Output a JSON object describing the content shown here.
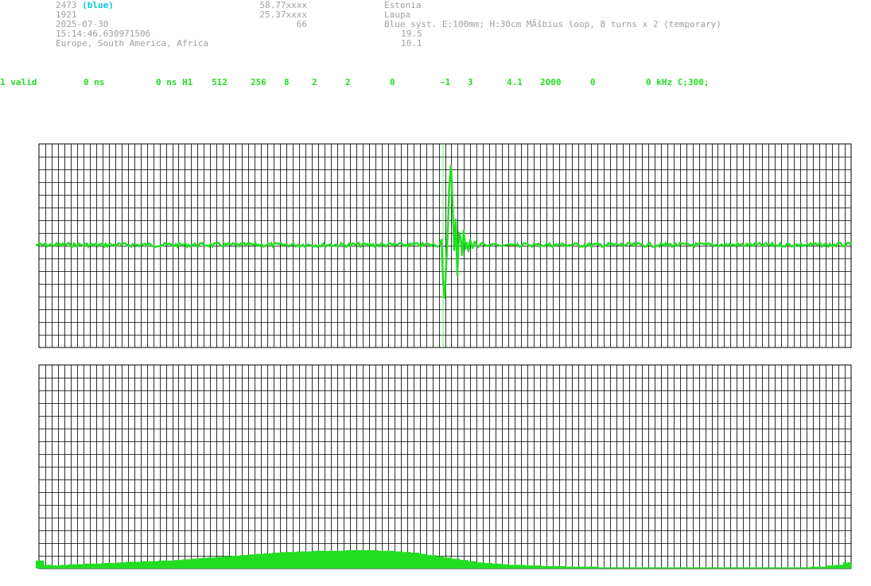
{
  "station": {
    "id": "2473",
    "color_label": "(blue)",
    "number": "1921",
    "date": "2025-07-30",
    "time": "15:14:46.630971506",
    "regions": "Europe, South America, Africa"
  },
  "coords": {
    "lat": "58.77xxxx",
    "lon": "25.37xxxx",
    "alt": "66"
  },
  "location": {
    "country": "Estonia",
    "place": "Laupa",
    "antenna": "Blue syst. E:100mm; H:30cm MÃšbius loop, 8 turns x 2 (temporary)",
    "value1": "19.5",
    "value2": "10.1"
  },
  "status_line": {
    "f01": "1 valid",
    "f02": "0 ns",
    "f03": "0 ns H1",
    "f04": "512",
    "f05": "256",
    "f06": "8",
    "f07": "2",
    "f08": "2",
    "f09": "0",
    "f10": "-1",
    "f11": "3",
    "f12": "4.1",
    "f13": "2000",
    "f14": "0",
    "f15": "0 kHz C;300;"
  },
  "colors": {
    "signal": "#22dd22",
    "grid": "#000000",
    "header_text": "#a0a0a0",
    "accent": "#00c8e0",
    "marker": "#66ee66"
  },
  "waveform": {
    "baseline_noise_level": 0.02,
    "pulse_peak_max": 0.78,
    "pulse_peak_min": -0.52,
    "marker_fraction": 0.497
  },
  "spectrum": {
    "bars": [
      0.13,
      0.06,
      0.05,
      0.06,
      0.07,
      0.07,
      0.08,
      0.08,
      0.09,
      0.09,
      0.1,
      0.11,
      0.11,
      0.12,
      0.12,
      0.13,
      0.13,
      0.14,
      0.15,
      0.16,
      0.17,
      0.18,
      0.19,
      0.2,
      0.21,
      0.22,
      0.23,
      0.24,
      0.25,
      0.26,
      0.27,
      0.27,
      0.28,
      0.28,
      0.29,
      0.29,
      0.29,
      0.29,
      0.3,
      0.3,
      0.3,
      0.3,
      0.29,
      0.29,
      0.28,
      0.27,
      0.26,
      0.24,
      0.22,
      0.2,
      0.18,
      0.16,
      0.14,
      0.12,
      0.1,
      0.09,
      0.08,
      0.07,
      0.06,
      0.06,
      0.05,
      0.05,
      0.04,
      0.04,
      0.04,
      0.03,
      0.03,
      0.03,
      0.03,
      0.02,
      0.02,
      0.02,
      0.02,
      0.02,
      0.02,
      0.02,
      0.02,
      0.02,
      0.02,
      0.02,
      0.02,
      0.02,
      0.02,
      0.02,
      0.02,
      0.02,
      0.02,
      0.02,
      0.02,
      0.02,
      0.02,
      0.02,
      0.02,
      0.02,
      0.02,
      0.03,
      0.03,
      0.05,
      0.06,
      0.1
    ]
  }
}
